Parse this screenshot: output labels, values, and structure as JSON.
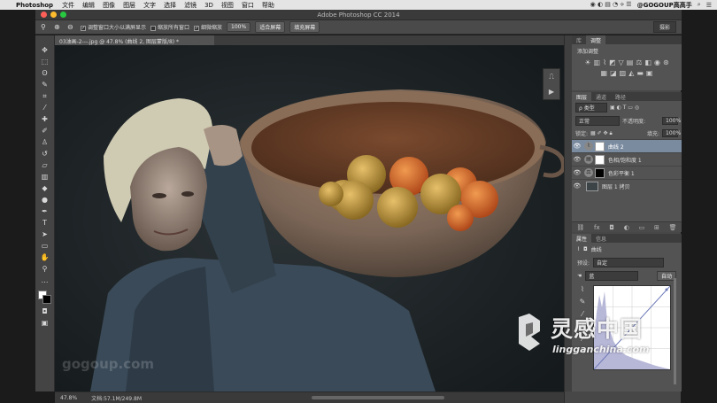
{
  "menubar": {
    "app_name": "Photoshop",
    "items": [
      "文件",
      "编辑",
      "图像",
      "图层",
      "文字",
      "选择",
      "滤镜",
      "3D",
      "视图",
      "窗口",
      "帮助"
    ],
    "user": "@GOGOUP高高手"
  },
  "window": {
    "title": "Adobe Photoshop CC 2014"
  },
  "options_bar": {
    "resize_windows_label": "调整窗口大小以满屏显示",
    "zoom_all_label": "缩放所有窗口",
    "scrubby_zoom_label": "细微缩放",
    "btn_100": "100%",
    "btn_fit": "适合屏幕",
    "btn_fill": "填充屏幕",
    "workspace": "摄影"
  },
  "document": {
    "tab_label": "03油画-2---.jpg @ 47.8% (曲线 2, 图层蒙版/8) *"
  },
  "status": {
    "zoom": "47.8%",
    "doc_size": "文档:57.1M/249.8M"
  },
  "adjustments_panel": {
    "tabs": [
      "库",
      "调整"
    ],
    "active_tab": "调整",
    "heading": "添加调整"
  },
  "layers_panel": {
    "tabs": [
      "图层",
      "通道",
      "路径"
    ],
    "active_tab": "图层",
    "kind_filter": "ρ 类型",
    "blend_mode": "正常",
    "opacity_label": "不透明度:",
    "opacity_value": "100%",
    "lock_label": "锁定:",
    "fill_label": "填充:",
    "fill_value": "100%",
    "layers": [
      {
        "name": "曲线 2",
        "type": "adjustment",
        "active": true
      },
      {
        "name": "色相/饱和度 1",
        "type": "adjustment",
        "active": false
      },
      {
        "name": "色彩平衡 1",
        "type": "adjustment",
        "active": false
      },
      {
        "name": "图层 1 拷贝",
        "type": "pixel",
        "active": false
      }
    ]
  },
  "properties_panel": {
    "tabs": [
      "属性",
      "信息"
    ],
    "active_tab": "属性",
    "title": "曲线",
    "preset_label": "预设:",
    "preset_value": "自定",
    "channel_value": "蓝",
    "auto_label": "自动"
  },
  "watermarks": {
    "left": "gogoup.com",
    "right_cn": "灵感中国",
    "right_en": "lingganchina.com"
  },
  "colors": {
    "ps_dark": "#474747",
    "ps_panel": "#535353",
    "layer_highlight": "#7a8ba0",
    "canvas_bg": "#1e2326"
  }
}
